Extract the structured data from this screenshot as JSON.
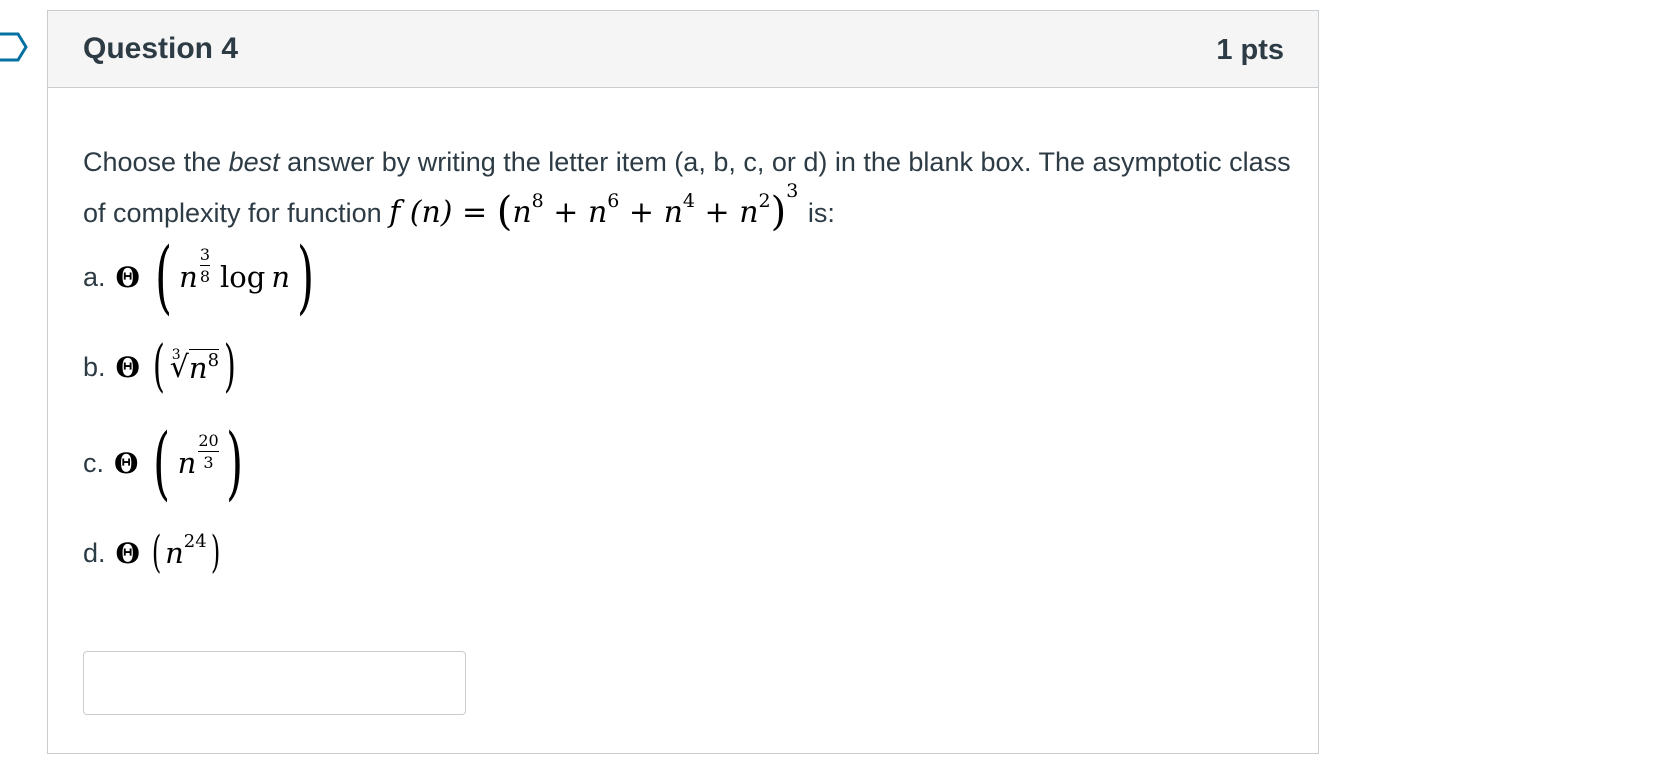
{
  "question": {
    "title": "Question 4",
    "points": "1 pts",
    "prompt_part1": "Choose the ",
    "prompt_emphasis": "best",
    "prompt_part2": " answer by writing the letter item (a, b, c, or d) in the blank box. The asymptotic class of complexity for function ",
    "prompt_part3": " is:",
    "formula": {
      "lhs": "f (n) = ",
      "open": "(",
      "t1": "n",
      "e1": "8",
      "plus1": " + n",
      "e2": "6",
      "plus2": " + n",
      "e3": "4",
      "plus3": " + n",
      "e4": "2",
      "close": ")",
      "outer_exp": "3"
    },
    "options": [
      {
        "letter": "a.",
        "theta": "Θ",
        "base": "n",
        "exp_num": "3",
        "exp_den": "8",
        "log": "log",
        "log_arg": "n"
      },
      {
        "letter": "b.",
        "theta": "Θ",
        "root_index": "3",
        "radical": "√",
        "base": "n",
        "exp": "8"
      },
      {
        "letter": "c.",
        "theta": "Θ",
        "base": "n",
        "exp_num": "20",
        "exp_den": "3"
      },
      {
        "letter": "d.",
        "theta": "Θ",
        "base": "n",
        "exp": "24"
      }
    ],
    "answer_box": {
      "value": "",
      "placeholder": ""
    }
  },
  "colors": {
    "header_bg": "#f5f5f5",
    "border": "#c7cdd1",
    "text": "#2d3b45"
  },
  "icons": {
    "flag": "flag-outline-icon"
  }
}
